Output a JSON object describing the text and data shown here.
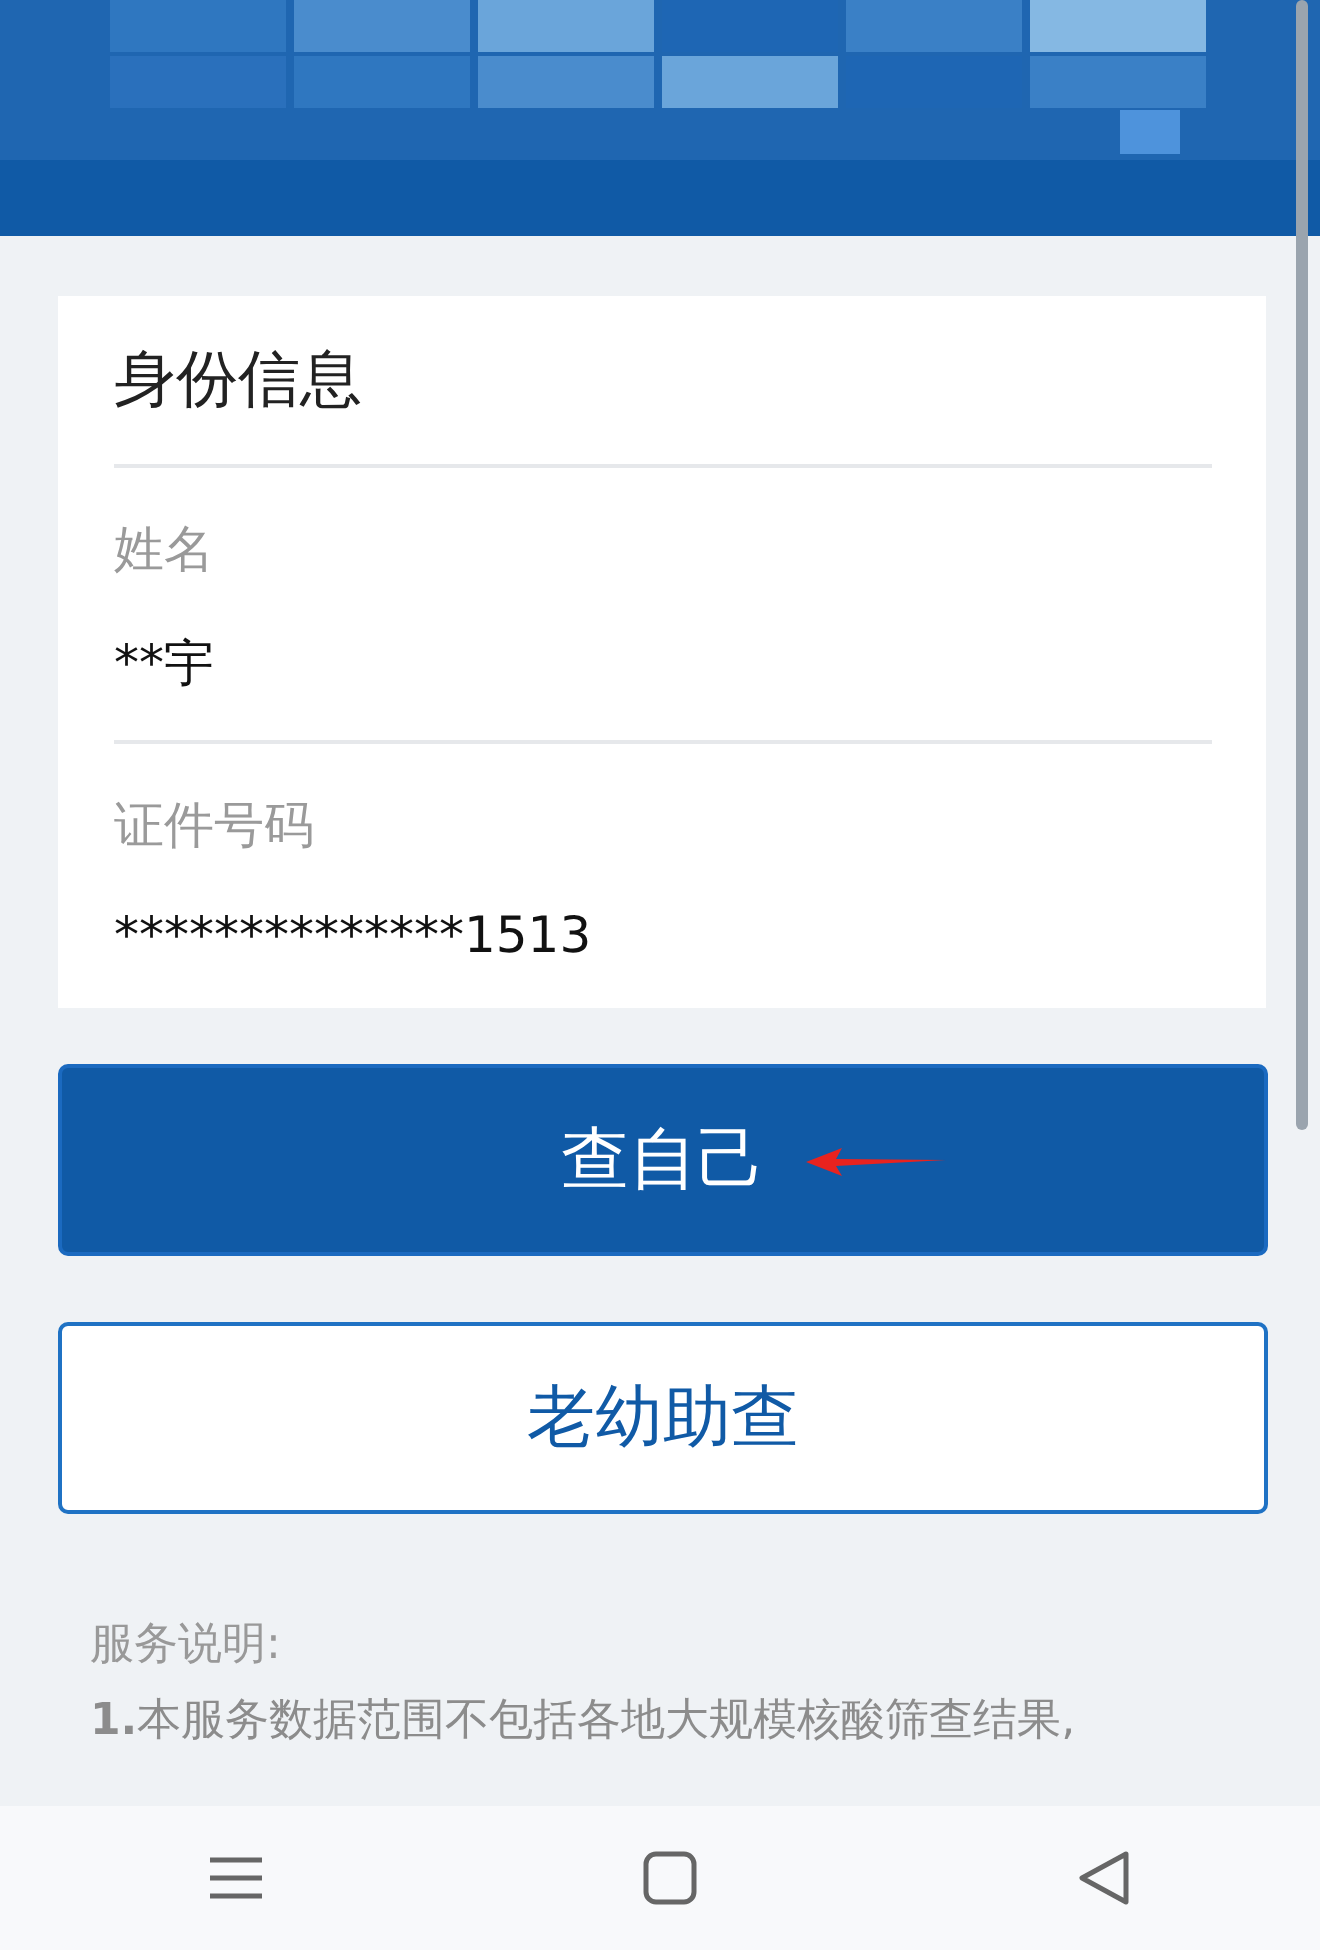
{
  "identity_card": {
    "title": "身份信息",
    "fields": [
      {
        "label": "姓名",
        "value": "**宇"
      },
      {
        "label": "证件号码",
        "value": "**************1513"
      }
    ]
  },
  "buttons": [
    {
      "label": "查自己",
      "kind": "primary",
      "annotated": true
    },
    {
      "label": "老幼助查",
      "kind": "outline",
      "annotated": false
    }
  ],
  "notes": {
    "heading": "服务说明:",
    "lines": [
      "**1.**本服务数据范围不包括各地大规模核酸筛查结果,"
    ]
  },
  "nav_bar": [
    {
      "kind": "menu"
    },
    {
      "kind": "home"
    },
    {
      "kind": "back"
    }
  ]
}
